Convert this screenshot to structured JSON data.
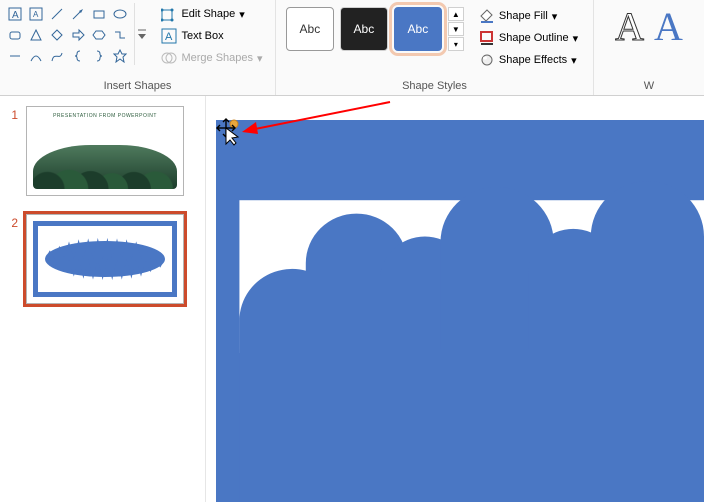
{
  "ribbon": {
    "insertShapes": {
      "label": "Insert Shapes",
      "editShape": "Edit Shape",
      "textBox": "Text Box",
      "mergeShapes": "Merge Shapes"
    },
    "shapeStyles": {
      "label": "Shape Styles",
      "swatchText": "Abc",
      "shapeFill": "Shape Fill",
      "shapeOutline": "Shape Outline",
      "shapeEffects": "Shape Effects"
    },
    "wordArt": {
      "label": "W"
    }
  },
  "thumbs": {
    "slide1": {
      "num": "1",
      "title": "PRESENTATION FROM POWERPOINT",
      "sub": ""
    },
    "slide2": {
      "num": "2"
    }
  },
  "colors": {
    "accent": "#4a77c4",
    "selection": "#cc4b2c"
  }
}
